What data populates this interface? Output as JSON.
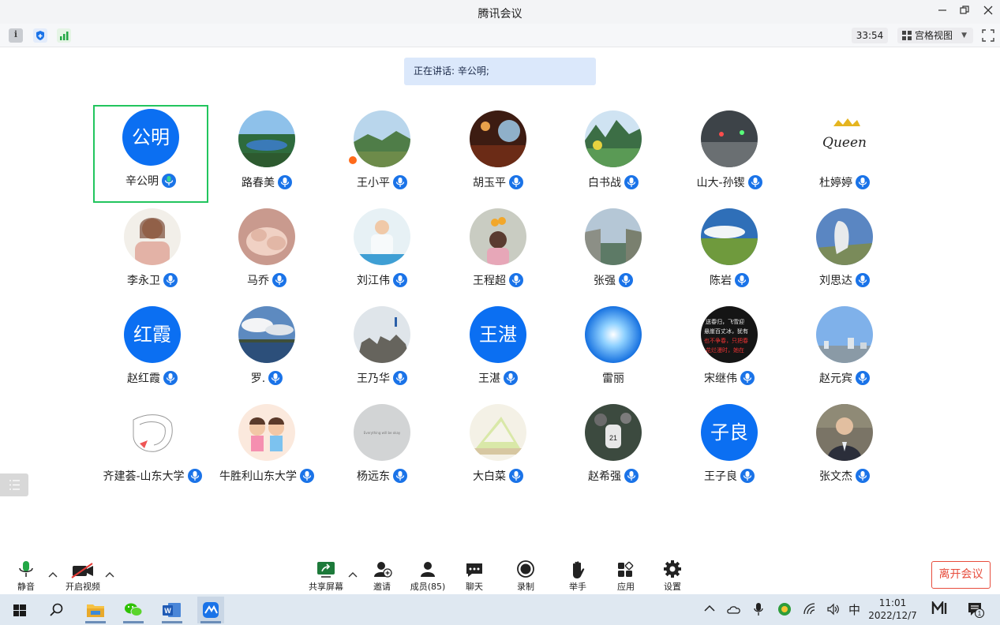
{
  "window": {
    "title": "腾讯会议"
  },
  "topbar": {
    "timer": "33:54",
    "view_label": "宫格视图"
  },
  "banner": {
    "speaking_text": "正在讲话: 辛公明;"
  },
  "participants": [
    {
      "name": "辛公明",
      "avatar_text": "公明"
    },
    {
      "name": "路春美"
    },
    {
      "name": "王小平"
    },
    {
      "name": "胡玉平"
    },
    {
      "name": "白书战"
    },
    {
      "name": "山大-孙锲"
    },
    {
      "name": "杜婷婷"
    },
    {
      "name": "李永卫"
    },
    {
      "name": "马乔"
    },
    {
      "name": "刘江伟"
    },
    {
      "name": "王程超"
    },
    {
      "name": "张强"
    },
    {
      "name": "陈岩"
    },
    {
      "name": "刘思达"
    },
    {
      "name": "赵红霞",
      "avatar_text": "红霞"
    },
    {
      "name": "罗."
    },
    {
      "name": "王乃华"
    },
    {
      "name": "王湛",
      "avatar_text": "王湛"
    },
    {
      "name": "雷丽"
    },
    {
      "name": "宋继伟"
    },
    {
      "name": "赵元宾"
    },
    {
      "name": "齐建荟-山东大学"
    },
    {
      "name": "牛胜利山东大学"
    },
    {
      "name": "杨远东"
    },
    {
      "name": "大白菜"
    },
    {
      "name": "赵希强"
    },
    {
      "name": "王子良",
      "avatar_text": "子良"
    },
    {
      "name": "张文杰"
    }
  ],
  "controls": {
    "mute": "静音",
    "video": "开启视频",
    "share": "共享屏幕",
    "invite": "邀请",
    "members": "成员(85)",
    "chat": "聊天",
    "record": "录制",
    "raise_hand": "举手",
    "apps": "应用",
    "settings": "设置",
    "leave": "离开会议"
  },
  "taskbar": {
    "ime": "中",
    "time": "11:01",
    "date": "2022/12/7"
  },
  "colors": {
    "accent": "#0b6ff2",
    "active_border": "#22c55e",
    "leave": "#e74c3c"
  }
}
